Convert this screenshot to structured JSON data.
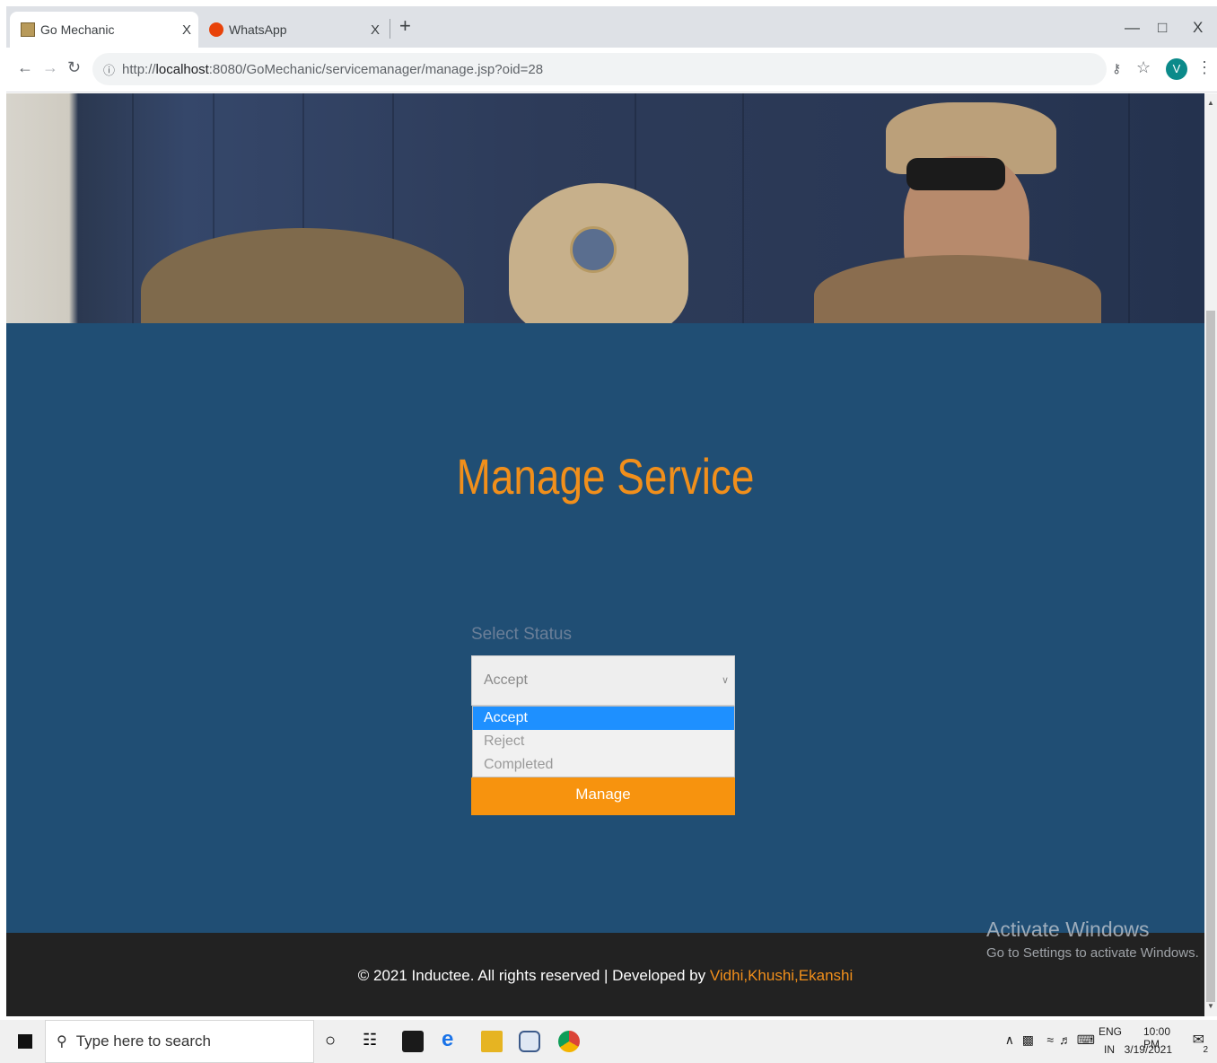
{
  "browser": {
    "tabs": [
      {
        "title": "Go Mechanic",
        "active": true
      },
      {
        "title": "WhatsApp",
        "active": false
      }
    ],
    "new_tab": "+",
    "url_scheme": "http://",
    "url_host": "localhost",
    "url_rest": ":8080/GoMechanic/servicemanager/manage.jsp?oid=28",
    "profile_initial": "V",
    "close_glyph": "X"
  },
  "page": {
    "title": "Manage Service",
    "status_label": "Select Status",
    "select": {
      "value": "Accept",
      "options": [
        "Accept",
        "Reject",
        "Completed"
      ]
    },
    "manage_button": "Manage"
  },
  "footer": {
    "text": "© 2021 Inductee. All rights reserved | Developed by ",
    "developers": "Vidhi,Khushi,Ekanshi"
  },
  "watermark": {
    "line1": "Activate Windows",
    "line2": "Go to Settings to activate Windows."
  },
  "taskbar": {
    "search_placeholder": "Type here to search",
    "language": "ENG",
    "region": "IN",
    "time": "10:00 PM",
    "date": "3/19/2021",
    "notification_count": "2"
  },
  "colors": {
    "accent": "#f18f1b",
    "main_bg": "#204e74",
    "footer_bg": "#222222",
    "select_highlight": "#1e90ff"
  }
}
